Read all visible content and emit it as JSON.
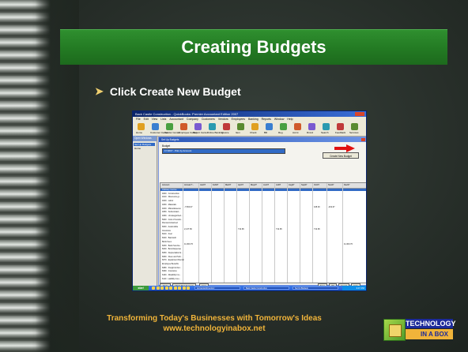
{
  "slide": {
    "title": "Creating Budgets",
    "bullet": "Click Create New Budget",
    "footer_line1": "Transforming Today's Businesses with Tomorrow's Ideas",
    "footer_line2": "www.technologyinabox.net",
    "logo_line1": "TECHNOLOGY",
    "logo_line2": "IN A BOX",
    "accent_color": "#2f8f2f",
    "footer_color": "#f0b43a"
  },
  "screenshot": {
    "window_title": "Back Castle Construction - QuickBooks: Premier Accountant Edition 2007",
    "menu": [
      "File",
      "Edit",
      "View",
      "Lists",
      "Accountant",
      "Company",
      "Customers",
      "Vendors",
      "Employees",
      "Banking",
      "Reports",
      "Window",
      "Help"
    ],
    "toolbar": [
      "Home",
      "Customer Center",
      "Vendor Center",
      "Employee Center",
      "Report Center",
      "Online Banking",
      "Invoice",
      "Item",
      "Check",
      "Bill",
      "Reg",
      "Accnt",
      "Rmnd",
      "Search",
      "Feedback",
      "Services"
    ],
    "side_panel": {
      "header": "Open Windows",
      "items": [
        "Set Up Budgets",
        "Home"
      ]
    },
    "dialog_title": "Set Up Budgets",
    "budget_label": "Budget",
    "budget_select": "FY2007 - P&L by Account",
    "create_button": "Create New Budget",
    "grid_headers": [
      "Account",
      "Annual T...",
      "Jan07",
      "Feb07",
      "Mar07",
      "Apr07",
      "May07",
      "Jun07",
      "Jul07",
      "Aug07",
      "Sep07",
      "Oct07",
      "Nov07",
      "Dec07"
    ],
    "grid_rows": [
      "Ordinary Income",
      "4000 · Construction",
      "4010 · Discounts gi...",
      "4020 · Labor",
      "4030 · Materials",
      "4040 · Miscellaneous",
      "4050 · Subcontract...",
      "4060 · Uncategorized...",
      "5000 · Cost of Goods...",
      "Discounts Earned",
      "6000 · Automobile",
      "Insurance",
      "6010 · Fuel",
      "6020 · Bad debt",
      "Bank Fees",
      "6030 · Bank Service...",
      "6040 · Bond Expense",
      "6050 · Depreciation E...",
      "6060 · Dues and Sub...",
      "6070 · Equipment Rental",
      "Employee Benefits",
      "6080 · Freight & Del...",
      "6090 · Insurance",
      "6100 · Disability Ins...",
      "6110 · Liability Insu..."
    ],
    "grid_values": [
      "-7,500.07",
      "108.00",
      "-419.67",
      "2,137.66",
      "712.96",
      "712.96",
      "712.96",
      "11,300.76",
      "11,300.76"
    ],
    "grid_buttons": [
      "Clear",
      "Adjust Row Amounts",
      "Copy Across",
      "Save",
      "OK",
      "Cancel",
      "Help"
    ],
    "taskbar": {
      "start": "start",
      "items": [
        "Accountant/Inventory",
        "Back Castle Construction",
        "Set Up Budgets"
      ],
      "clock": "3:47 PM"
    }
  }
}
